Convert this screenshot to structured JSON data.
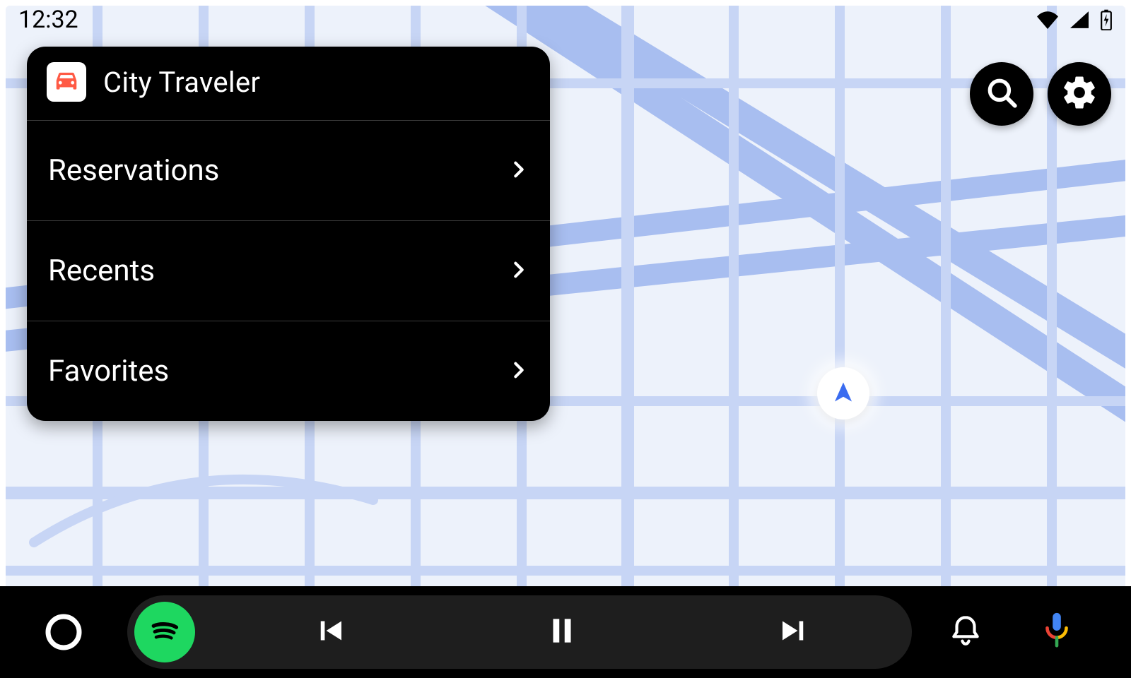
{
  "status": {
    "time": "12:32"
  },
  "panel": {
    "app_name": "City Traveler",
    "items": [
      {
        "label": "Reservations"
      },
      {
        "label": "Recents"
      },
      {
        "label": "Favorites"
      }
    ]
  },
  "action_buttons": {
    "search": "search",
    "settings": "settings"
  },
  "bottom": {
    "home": "home",
    "media_app": "spotify",
    "prev": "previous-track",
    "playpause": "pause",
    "next": "next-track",
    "notifications": "notifications",
    "mic": "microphone"
  },
  "colors": {
    "map_bg": "#edf2fb",
    "road": "#c7d5f5",
    "road_major": "#a8bef0",
    "accent_blue": "#3a6cf0",
    "spotify": "#1ed760",
    "car_icon": "#ff5a45"
  }
}
